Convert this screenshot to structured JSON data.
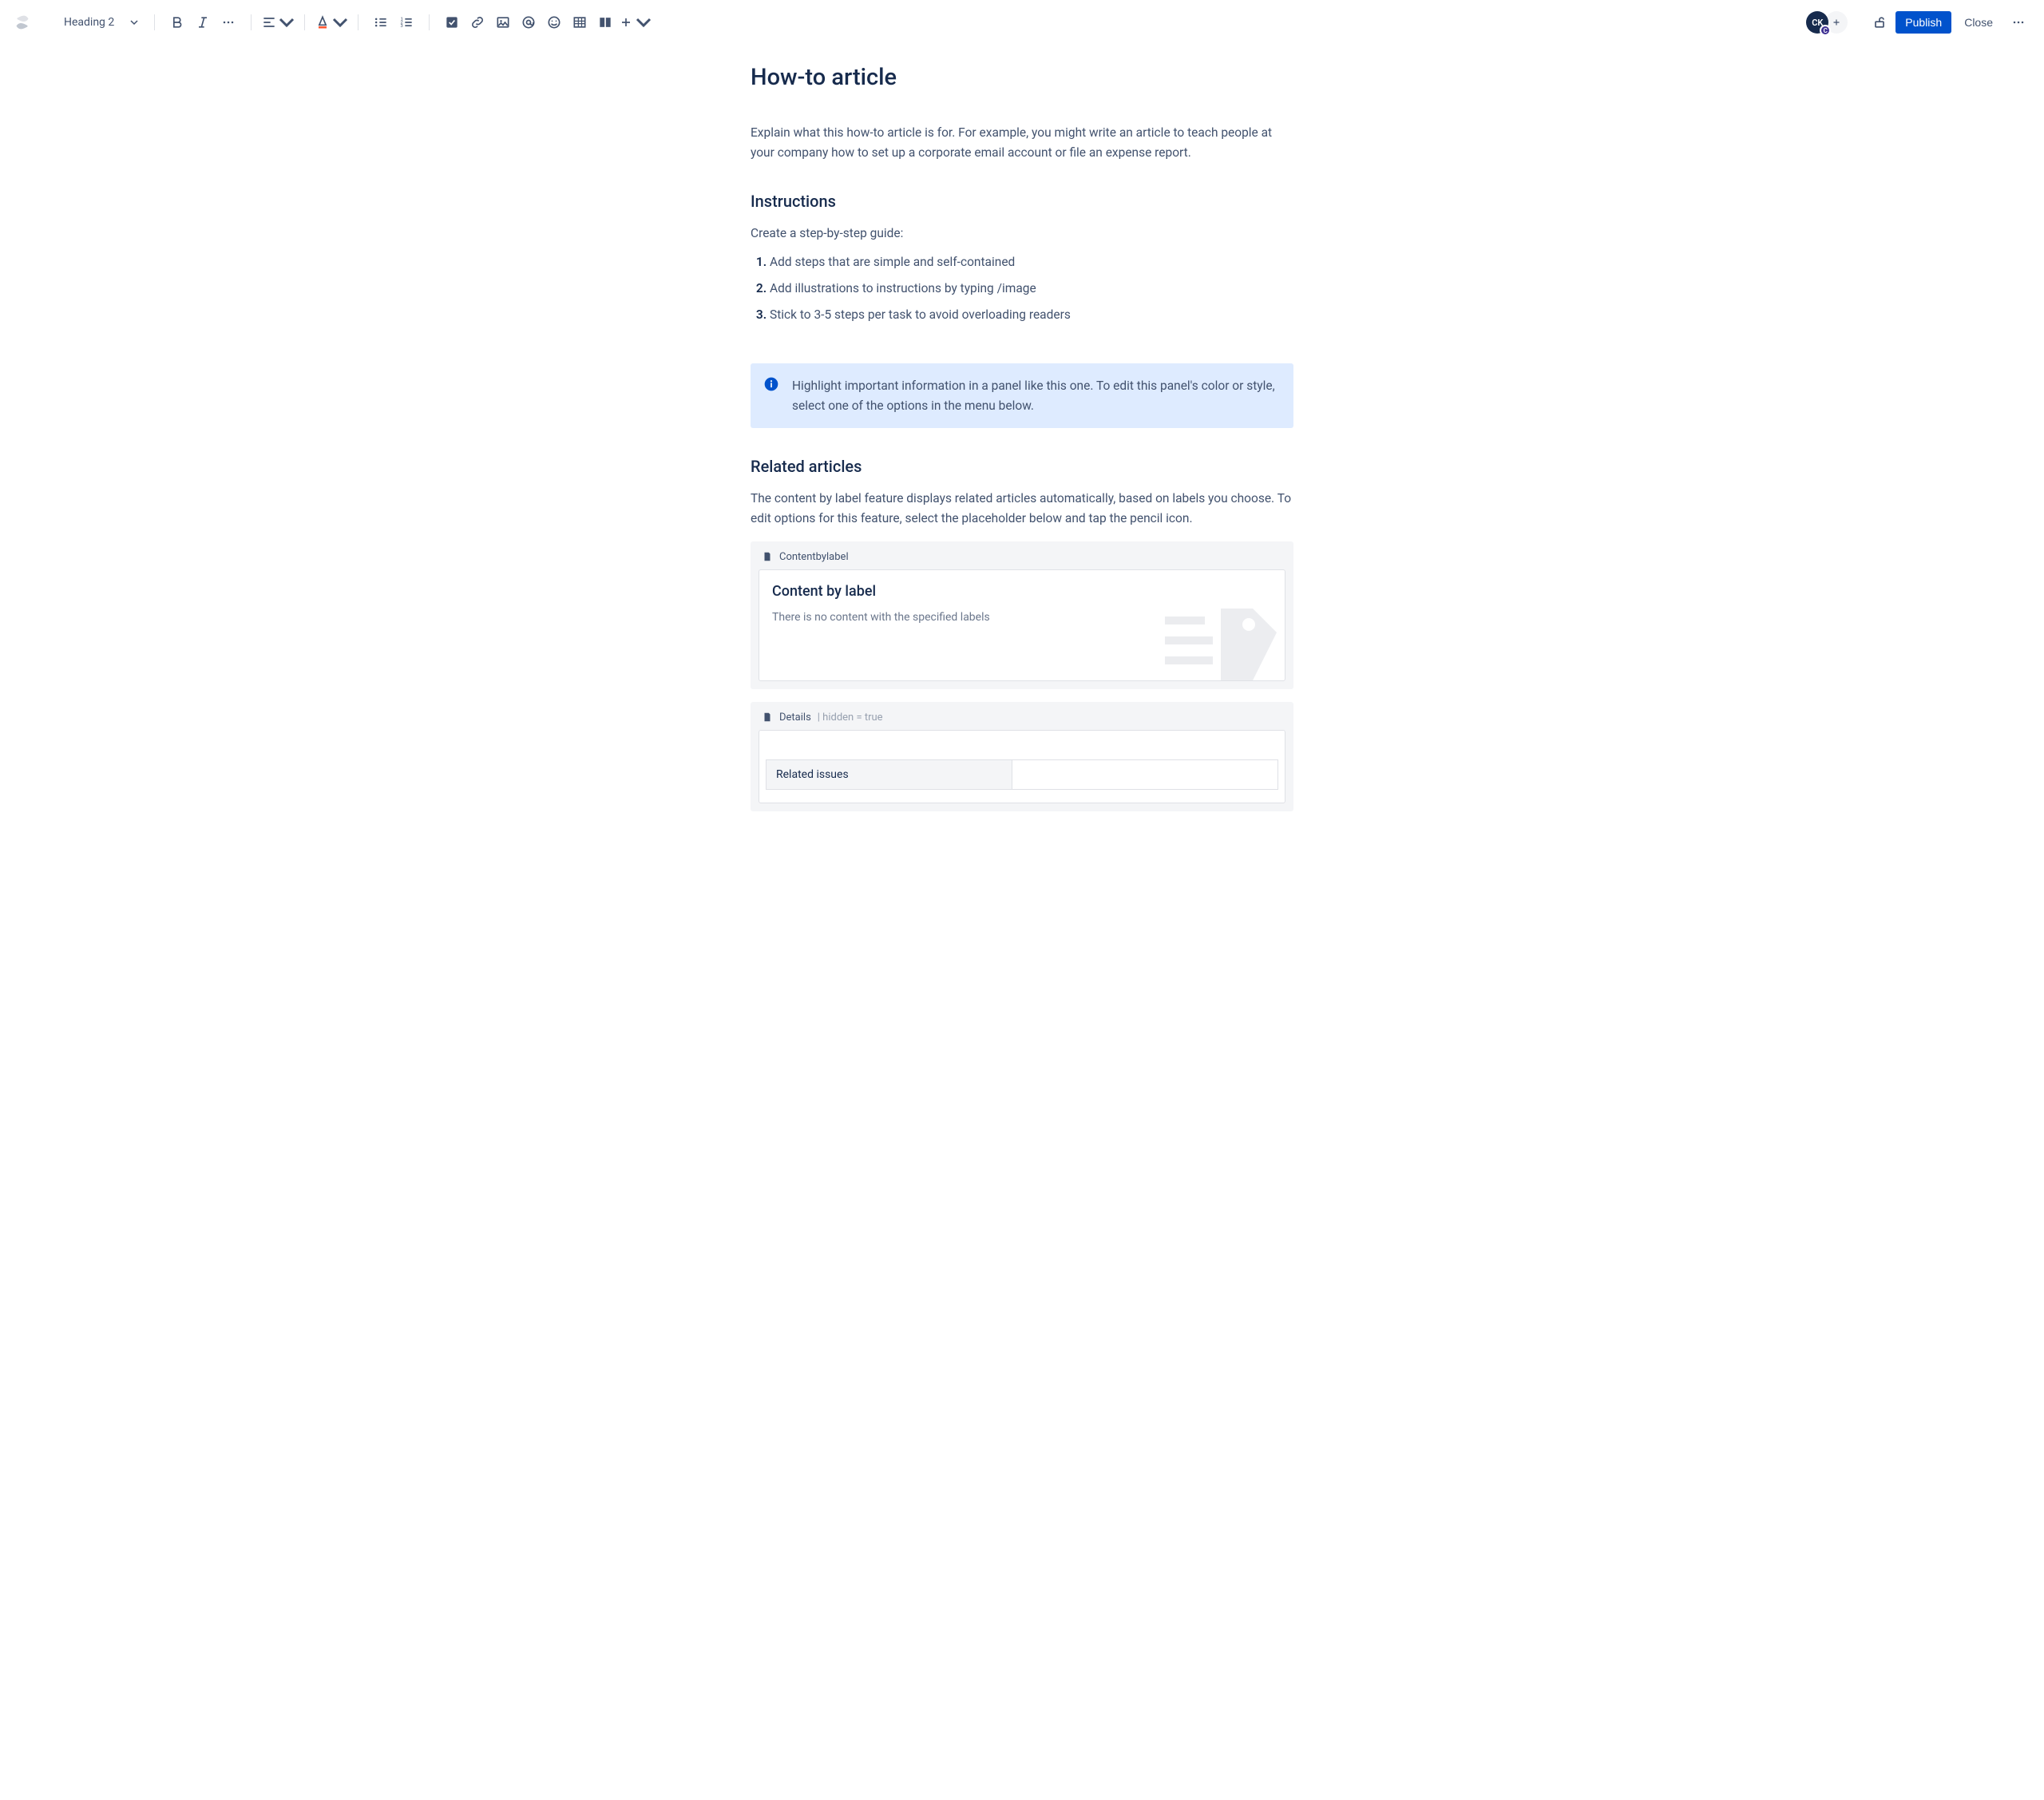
{
  "toolbar": {
    "heading_selector": "Heading 2",
    "publish": "Publish",
    "close": "Close"
  },
  "avatar": {
    "initials": "CK",
    "badge": "C"
  },
  "page": {
    "title": "How-to article",
    "intro": "Explain what this how-to article is for. For example, you might write an article to teach people at your company how to set up a corporate email account or file an expense report.",
    "instructions_heading": "Instructions",
    "instructions_lead": "Create a step-by-step guide:",
    "steps": [
      "Add steps that are simple and self-contained",
      "Add illustrations to instructions by typing /image",
      "Stick to 3-5 steps per task to avoid overloading readers"
    ],
    "panel_text": "Highlight important information in a panel like this one. To edit this panel's color or style, select one of the options in the menu below.",
    "related_heading": "Related articles",
    "related_text": "The content by label feature displays related articles automatically, based on labels you choose. To edit options for this feature, select the placeholder below and tap the pencil icon."
  },
  "content_by_label": {
    "macro_name": "Contentbylabel",
    "body_title": "Content by label",
    "empty_text": "There is no content with the specified labels"
  },
  "details": {
    "macro_name": "Details",
    "meta": "| hidden = true",
    "row_label": "Related issues"
  }
}
